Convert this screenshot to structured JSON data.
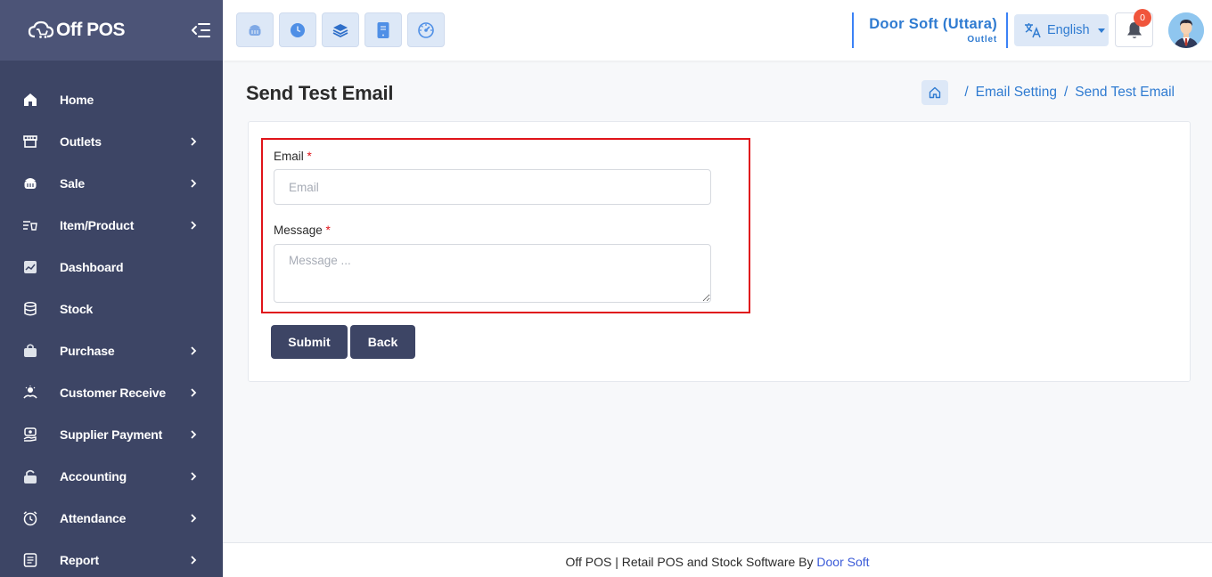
{
  "brand": {
    "name": "Off POS"
  },
  "sidebar": {
    "items": [
      {
        "label": "Home",
        "icon": "home-icon",
        "has_submenu": false
      },
      {
        "label": "Outlets",
        "icon": "store-icon",
        "has_submenu": true
      },
      {
        "label": "Sale",
        "icon": "basket-icon",
        "has_submenu": true
      },
      {
        "label": "Item/Product",
        "icon": "product-list-icon",
        "has_submenu": true
      },
      {
        "label": "Dashboard",
        "icon": "chart-icon",
        "has_submenu": false
      },
      {
        "label": "Stock",
        "icon": "database-icon",
        "has_submenu": false
      },
      {
        "label": "Purchase",
        "icon": "shopping-bag-icon",
        "has_submenu": true
      },
      {
        "label": "Customer Receive",
        "icon": "customer-receive-icon",
        "has_submenu": true
      },
      {
        "label": "Supplier Payment",
        "icon": "supplier-payment-icon",
        "has_submenu": true
      },
      {
        "label": "Accounting",
        "icon": "lock-icon",
        "has_submenu": true
      },
      {
        "label": "Attendance",
        "icon": "alarm-clock-icon",
        "has_submenu": true
      },
      {
        "label": "Report",
        "icon": "report-icon",
        "has_submenu": true
      }
    ]
  },
  "header": {
    "quick_buttons": [
      "pos-basket-icon",
      "clock-icon",
      "layers-icon",
      "tablet-icon",
      "dashboard-gauge-icon"
    ],
    "outlet_name": "Door Soft (Uttara)",
    "outlet_label": "Outlet",
    "language": "English",
    "notification_count": "0"
  },
  "page": {
    "title": "Send Test Email",
    "breadcrumb": [
      "Email Setting",
      "Send Test Email"
    ]
  },
  "form": {
    "email_label": "Email",
    "email_placeholder": "Email",
    "email_value": "",
    "message_label": "Message",
    "message_placeholder": "Message ...",
    "message_value": "",
    "required_mark": "*",
    "submit_label": "Submit",
    "back_label": "Back"
  },
  "footer": {
    "text": "Off POS | Retail POS and Stock Software By ",
    "link": "Door Soft"
  },
  "colors": {
    "sidebar_bg": "#3d4565",
    "accent_blue": "#2f7bd1",
    "highlight_red": "#e0141a",
    "badge_red": "#f0553c"
  }
}
